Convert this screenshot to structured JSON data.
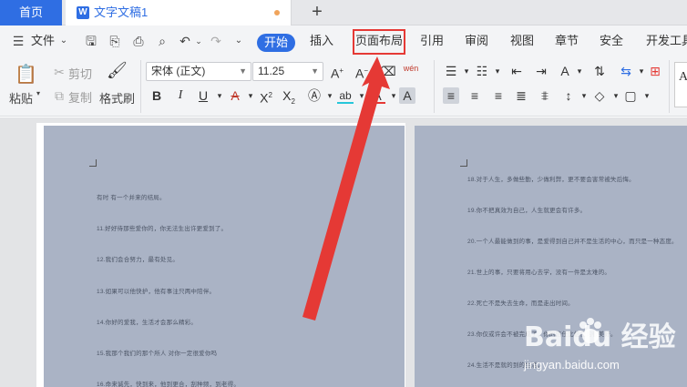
{
  "tabs": {
    "home": "首页",
    "doc_icon": "W",
    "doc_name": "文字文稿1",
    "add": "+"
  },
  "menu": {
    "file": "文件",
    "items": [
      {
        "id": "start",
        "label": "开始"
      },
      {
        "id": "insert",
        "label": "插入"
      },
      {
        "id": "layout",
        "label": "页面布局"
      },
      {
        "id": "reference",
        "label": "引用"
      },
      {
        "id": "review",
        "label": "审阅"
      },
      {
        "id": "view",
        "label": "视图"
      },
      {
        "id": "chapter",
        "label": "章节"
      },
      {
        "id": "security",
        "label": "安全"
      },
      {
        "id": "devtools",
        "label": "开发工具"
      }
    ]
  },
  "ribbon": {
    "paste": "粘贴",
    "cut": "剪切",
    "copy": "复制",
    "format_painter": "格式刷",
    "font_name": "宋体 (正文)",
    "font_size": "11.25",
    "pinyin": "wén",
    "char_a": "A"
  },
  "page1": {
    "lines": [
      "有时 有一个并来的结局。",
      "11.好好待那些爱你的，你无法生出许更爱到了。",
      "12.我们会合努力，最有处见。",
      "13.如果可以他快护，他有事注只两中陪伴。",
      "14.你好的爱我，生活才会那么精彩。",
      "15.我那个我们的那个所人 对你一定很爱你吗",
      "16.命来诚先，快到来，他到更合，刮种频，到老得。"
    ]
  },
  "page2": {
    "lines": [
      "18.对于人生，多做些勤，少做利弊，更不要会害常被失后悔。",
      "19.你不把真效为自己，人生就更会有许多。",
      "20.一个人最能做到的事，是爱得到自己并不是生活的中心，而只是一种态度。",
      "21.世上的事，只要将用心去学，没有一件是太难的。",
      "22.死亡不是失去生命，而是走出时间。",
      "23.你仅或许会不被完成了，你的信任比信任的很美好。",
      "24.生活不是就的到的生活。"
    ]
  },
  "watermark": {
    "brand": "Baidu 经验",
    "url": "jingyan.baidu.com"
  },
  "colors": {
    "accent": "#2f6ee3",
    "highlight_box": "#e53935",
    "page_bg": "#aab3c5"
  }
}
